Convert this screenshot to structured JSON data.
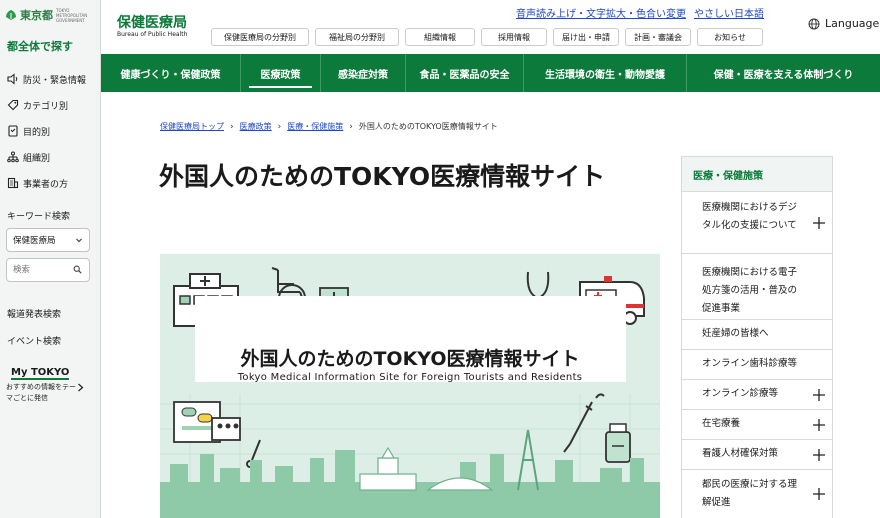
{
  "site": {
    "tokyo_logo_text": "東京都",
    "tokyo_logo_sub": "TOKYO METROPOLITAN GOVERNMENT",
    "bureau_title": "保健医療局",
    "bureau_en": "Bureau of Public Health",
    "language_label": "Language"
  },
  "utility_links": [
    "音声読み上げ・文字拡大・色合い変更",
    "やさしい日本語"
  ],
  "header_pills": [
    "保健医療局の分野別",
    "福祉局の分野別",
    "組織情報",
    "採用情報",
    "届け出・申請",
    "計画・審議会",
    "お知らせ"
  ],
  "main_nav": [
    {
      "label": "健康づくり・保健政策",
      "active": false
    },
    {
      "label": "医療政策",
      "active": true
    },
    {
      "label": "感染症対策",
      "active": false
    },
    {
      "label": "食品・医薬品の安全",
      "active": false
    },
    {
      "label": "生活環境の衛生・動物愛護",
      "active": false
    },
    {
      "label": "保健・医療を支える体制づくり",
      "active": false
    }
  ],
  "sidebar": {
    "heading": "都全体で探す",
    "items": [
      {
        "label": "防災・緊急情報",
        "icon": "speaker-icon"
      },
      {
        "label": "カテゴリ別",
        "icon": "tag-icon"
      },
      {
        "label": "目的別",
        "icon": "document-icon"
      },
      {
        "label": "組織別",
        "icon": "org-chart-icon"
      },
      {
        "label": "事業者の方",
        "icon": "building-icon"
      }
    ],
    "keyword_label": "キーワード検索",
    "select_value": "保健医療局",
    "search_placeholder": "検索",
    "press_link": "報道発表検索",
    "event_link": "イベント検索",
    "mytokyo_title": "My TOKYO",
    "mytokyo_text": "おすすめの情報をテーマごとに発信"
  },
  "breadcrumb": [
    "保健医療局トップ",
    "医療政策",
    "医療・保健施策"
  ],
  "breadcrumb_current": "外国人のためのTOKYO医療情報サイト",
  "page_title": "外国人のためのTOKYO医療情報サイト",
  "banner": {
    "title_jp": "外国人のためのTOKYO医療情報サイト",
    "title_en": "Tokyo Medical Information Site for Foreign Tourists and Residents"
  },
  "right_nav": {
    "heading": "医療・保健施策",
    "items": [
      {
        "label": "医療機関におけるデジタル化の支援について",
        "expandable": true
      },
      {
        "label": "医療機関における電子処方箋の活用・普及の促進事業",
        "expandable": false
      },
      {
        "label": "妊産婦の皆様へ",
        "expandable": false
      },
      {
        "label": "オンライン歯科診療等",
        "expandable": false
      },
      {
        "label": "オンライン診療等",
        "expandable": true
      },
      {
        "label": "在宅療養",
        "expandable": true
      },
      {
        "label": "看護人材確保対策",
        "expandable": true
      },
      {
        "label": "都民の医療に対する理解促進",
        "expandable": true
      }
    ]
  },
  "colors": {
    "brand_green": "#0c7a3a",
    "link_blue": "#1f47c8",
    "banner_bg": "#ddeee6"
  }
}
